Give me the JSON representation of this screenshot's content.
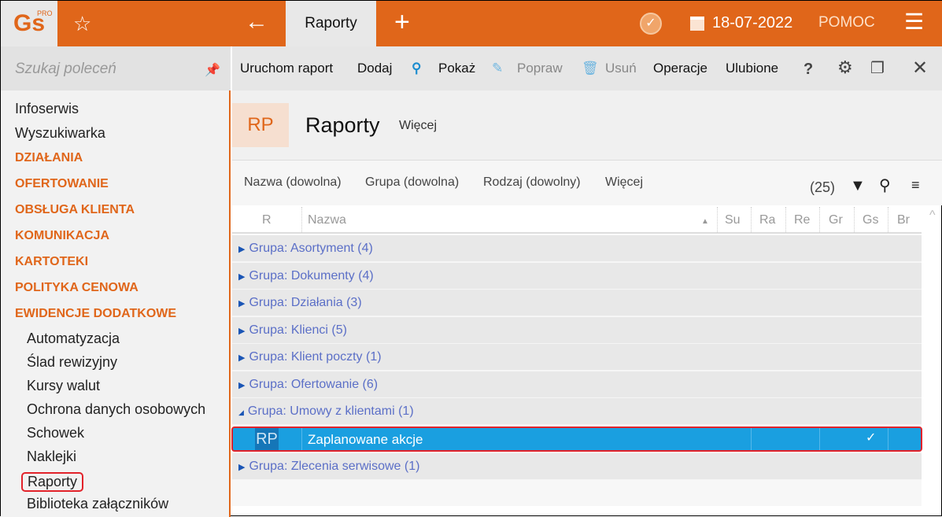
{
  "topbar": {
    "logo": "Gs",
    "logo_sup": "PRO",
    "tab": "Raporty",
    "date": "18-07-2022",
    "help": "POMOC"
  },
  "sidebar": {
    "search_placeholder": "Szukaj poleceń",
    "items": [
      "Infoserwis",
      "Wyszukiwarka"
    ],
    "categories": [
      "DZIAŁANIA",
      "OFERTOWANIE",
      "OBSŁUGA KLIENTA",
      "KOMUNIKACJA",
      "KARTOTEKI",
      "POLITYKA CENOWA",
      "EWIDENCJE DODATKOWE"
    ],
    "subitems": [
      "Automatyzacja",
      "Ślad rewizyjny",
      "Kursy walut",
      "Ochrona danych osobowych",
      "Schowek",
      "Naklejki",
      "Raporty",
      "Biblioteka załączników"
    ]
  },
  "toolbar": {
    "run": "Uruchom raport",
    "add": "Dodaj",
    "show": "Pokaż",
    "edit": "Popraw",
    "delete": "Usuń",
    "operations": "Operacje",
    "favorites": "Ulubione",
    "help": "?"
  },
  "header": {
    "badge": "RP",
    "title": "Raporty",
    "more": "Więcej"
  },
  "filters": {
    "name": "Nazwa (dowolna)",
    "group": "Grupa (dowolna)",
    "kind": "Rodzaj (dowolny)",
    "more": "Więcej",
    "count": "(25)"
  },
  "columns": [
    "R",
    "Nazwa",
    "Su",
    "Ra",
    "Re",
    "Gr",
    "Gs",
    "Br"
  ],
  "groups": [
    "Grupa: Asortyment (4)",
    "Grupa: Dokumenty (4)",
    "Grupa: Działania (3)",
    "Grupa: Klienci (5)",
    "Grupa: Klient poczty (1)",
    "Grupa: Ofertowanie (6)",
    "Grupa: Umowy z klientami (1)"
  ],
  "selected_row": {
    "badge": "RP",
    "name": "Zaplanowane akcje",
    "check": "✓"
  },
  "last_group": "Grupa: Zlecenia serwisowe (1)"
}
